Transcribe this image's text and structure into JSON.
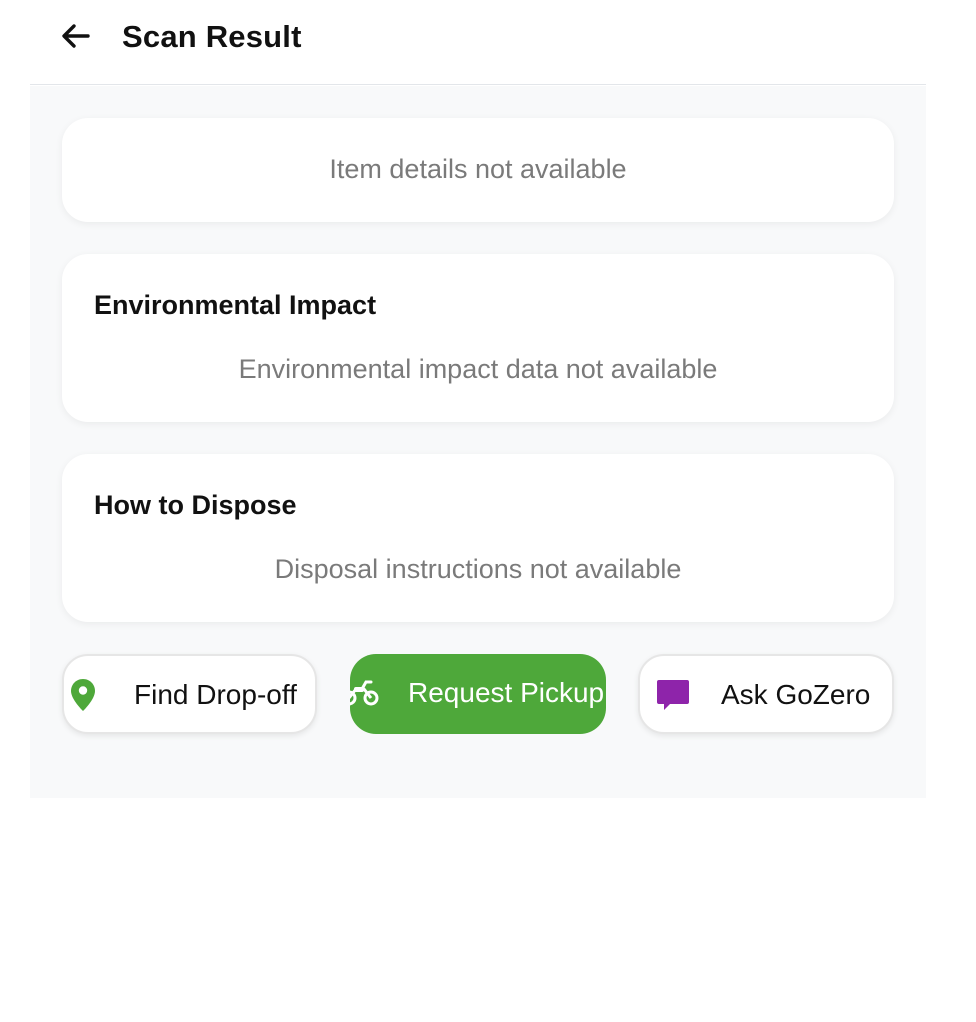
{
  "header": {
    "title": "Scan Result",
    "back_icon": "arrow-left-icon"
  },
  "item_card": {
    "message": "Item details not available"
  },
  "environmental_card": {
    "title": "Environmental Impact",
    "message": "Environmental impact data not available"
  },
  "dispose_card": {
    "title": "How to Dispose",
    "message": "Disposal instructions not available"
  },
  "actions": {
    "find_dropoff": {
      "label": "Find Drop-off",
      "icon": "map-pin-icon"
    },
    "request_pickup": {
      "label": "Request Pickup",
      "icon": "motorcycle-icon"
    },
    "ask_gozero": {
      "label": "Ask GoZero",
      "icon": "chat-bubble-icon"
    }
  },
  "colors": {
    "accent_green": "#4ea83a",
    "chat_purple": "#8e24aa",
    "background": "#f8f9fa"
  }
}
